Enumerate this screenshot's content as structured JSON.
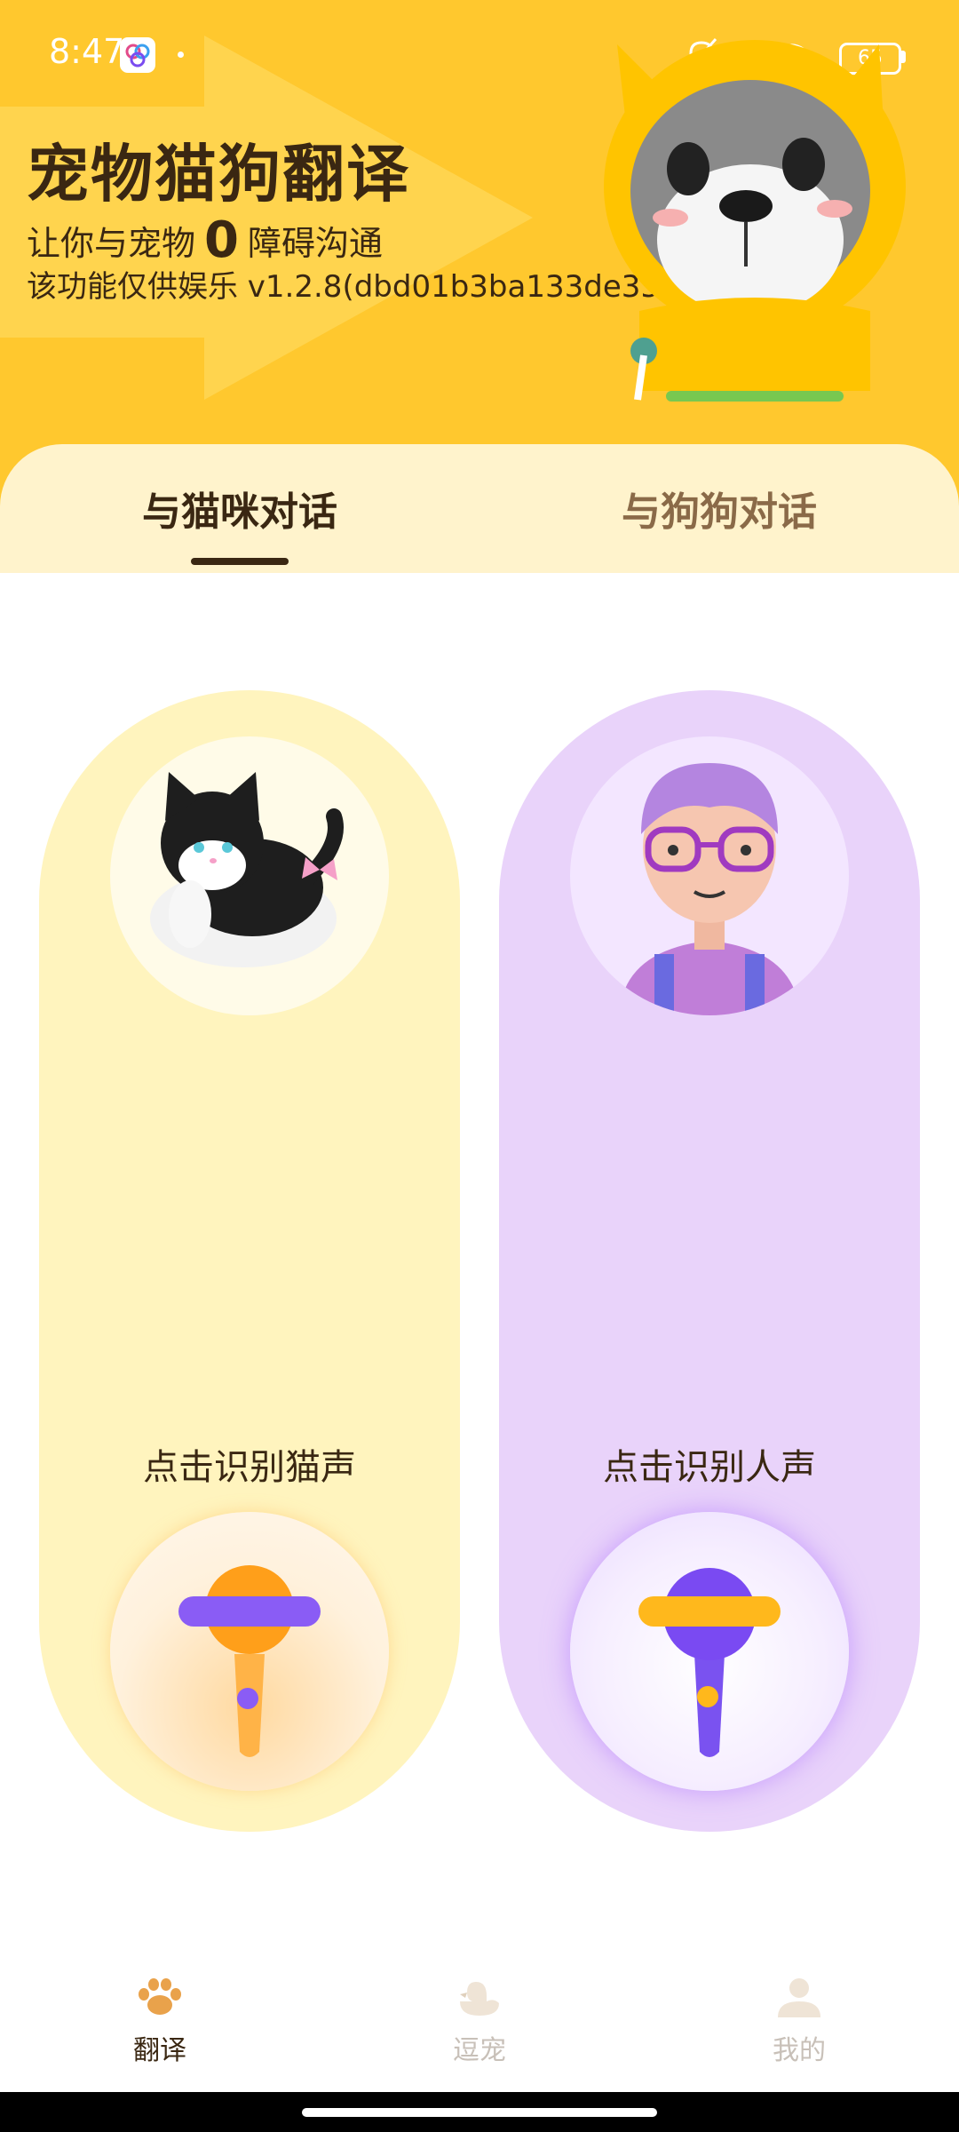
{
  "status_bar": {
    "time": "8:47",
    "battery": "65",
    "icons": [
      "app-notification-icon",
      "mute-bell-icon",
      "no-sim-icon",
      "wifi-icon",
      "battery-icon"
    ]
  },
  "header": {
    "title": "宠物猫狗翻译",
    "subtitle_before": "让你与宠物",
    "subtitle_zero": "0",
    "subtitle_after": "障碍沟通",
    "version": "该功能仅供娱乐 v1.2.8(dbd01b3ba133de35)"
  },
  "tabs": [
    {
      "label": "与猫咪对话",
      "active": true
    },
    {
      "label": "与狗狗对话",
      "active": false
    }
  ],
  "panels": {
    "cat": {
      "label": "点击识别猫声",
      "color": "#FFF4BE"
    },
    "human": {
      "label": "点击识别人声",
      "color": "#E9D3FA"
    }
  },
  "bottom_nav": [
    {
      "label": "翻译",
      "icon": "paw-icon",
      "active": true
    },
    {
      "label": "逗宠",
      "icon": "duck-icon",
      "active": false
    },
    {
      "label": "我的",
      "icon": "person-icon",
      "active": false
    }
  ],
  "colors": {
    "accent": "#FFC82E",
    "text_dark": "#3a2712"
  }
}
